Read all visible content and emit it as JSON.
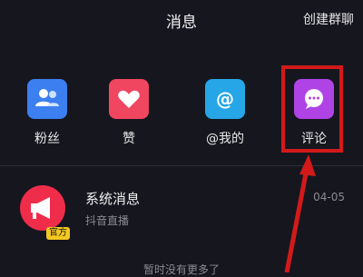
{
  "header": {
    "title": "消息",
    "action": "创建群聊"
  },
  "categories": [
    {
      "label": "粉丝",
      "icon": "fans-icon",
      "color": "#3c7ff0"
    },
    {
      "label": "赞",
      "icon": "heart-icon",
      "color": "#f0465f"
    },
    {
      "label": "@我的",
      "icon": "at-icon",
      "color": "#26a6e6"
    },
    {
      "label": "评论",
      "icon": "comment-icon",
      "color": "#b043e6"
    }
  ],
  "messages": [
    {
      "title": "系统消息",
      "subtitle": "抖音直播",
      "time": "04-05",
      "badge": "官方",
      "avatar_icon": "megaphone-icon",
      "avatar_color": "#ef2d4b"
    }
  ],
  "footer": {
    "note": "暂时没有更多了"
  },
  "annotation": {
    "color": "#d21a1a"
  }
}
